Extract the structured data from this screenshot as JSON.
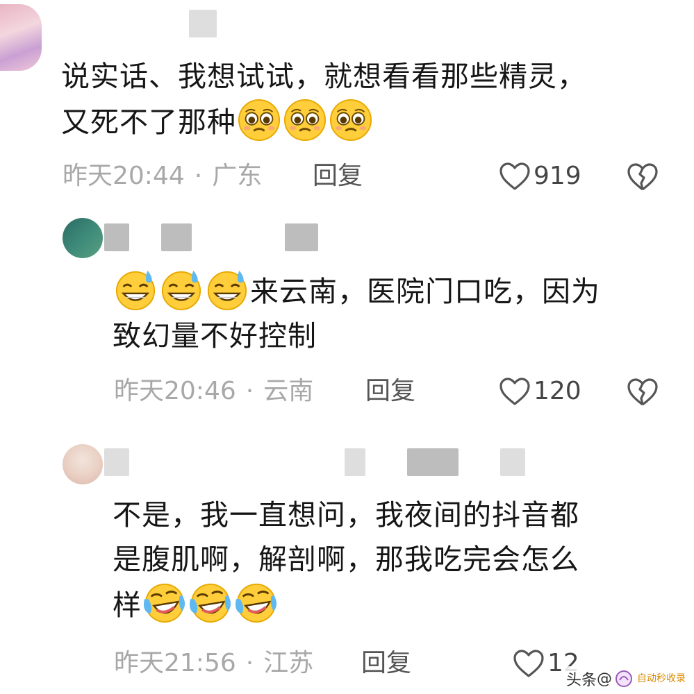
{
  "comments": [
    {
      "username": "",
      "lines": [
        "说实话、我想试试，就想看看那些精灵，",
        "又死不了那种"
      ],
      "emoji_after": "pleading-face",
      "time": "昨天20:44",
      "location": "广东",
      "reply_label": "回复",
      "likes": "919"
    },
    {
      "username": "",
      "emoji_before": "grinning-sweat-face",
      "lines": [
        "来云南，医院门口吃，因为",
        "致幻量不好控制"
      ],
      "time": "昨天20:46",
      "location": "云南",
      "reply_label": "回复",
      "likes": "120"
    },
    {
      "username": "",
      "lines": [
        "不是，我一直想问，我夜间的抖音都",
        "是腹肌啊，解剖啊，那我吃完会怎么",
        "样"
      ],
      "emoji_after": "laughing-crying-face",
      "time": "昨天21:56",
      "location": "江苏",
      "reply_label": "回复",
      "likes": "12"
    }
  ],
  "separator": "·",
  "watermark": {
    "platform": "头条",
    "at": "@",
    "site": "自动秒收录"
  },
  "colors": {
    "text": "#161616",
    "meta": "#a8a8a8",
    "icon": "#555555"
  }
}
